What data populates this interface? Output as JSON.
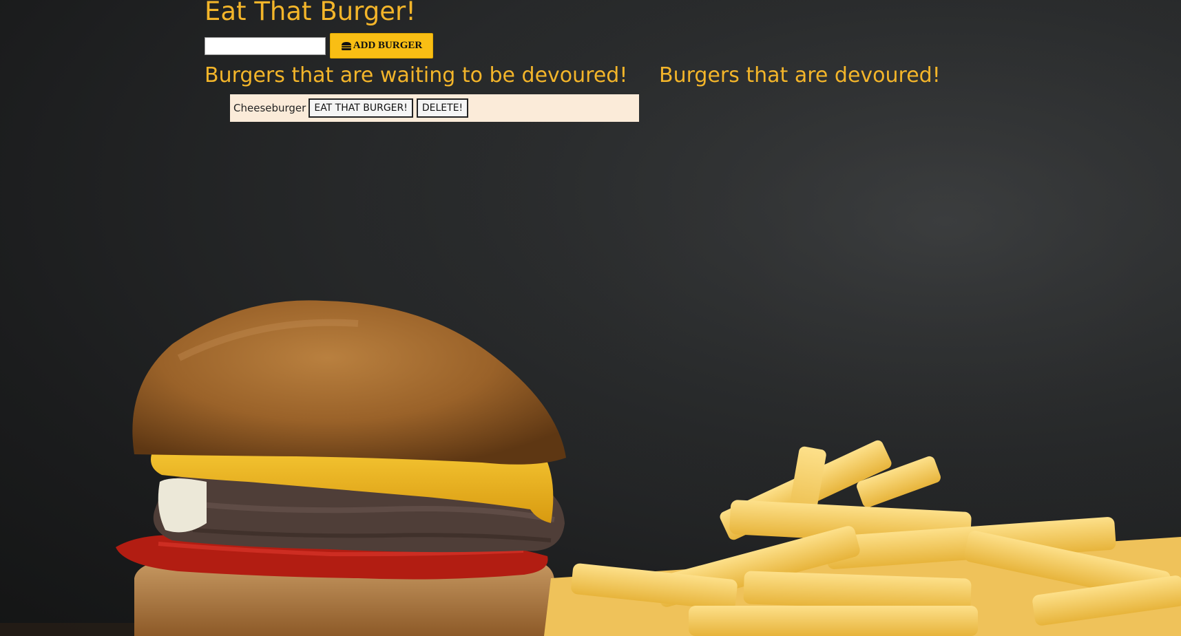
{
  "page": {
    "title": "Eat That Burger!"
  },
  "form": {
    "input_value": "",
    "input_placeholder": "",
    "add_button_label": "ADD BURGER",
    "add_button_icon": "hamburger-icon"
  },
  "columns": {
    "waiting_heading": "Burgers that are waiting to be devoured!",
    "devoured_heading": "Burgers that are devoured!"
  },
  "waiting_burgers": [
    {
      "name": "Cheeseburger",
      "eat_label": "EAT THAT BURGER!",
      "delete_label": "DELETE!"
    }
  ],
  "devoured_burgers": [],
  "colors": {
    "heading": "#f3b52a",
    "button_accent": "#f9be14",
    "list_item_bg": "#fbebd9",
    "background": "#1b1c1d"
  }
}
